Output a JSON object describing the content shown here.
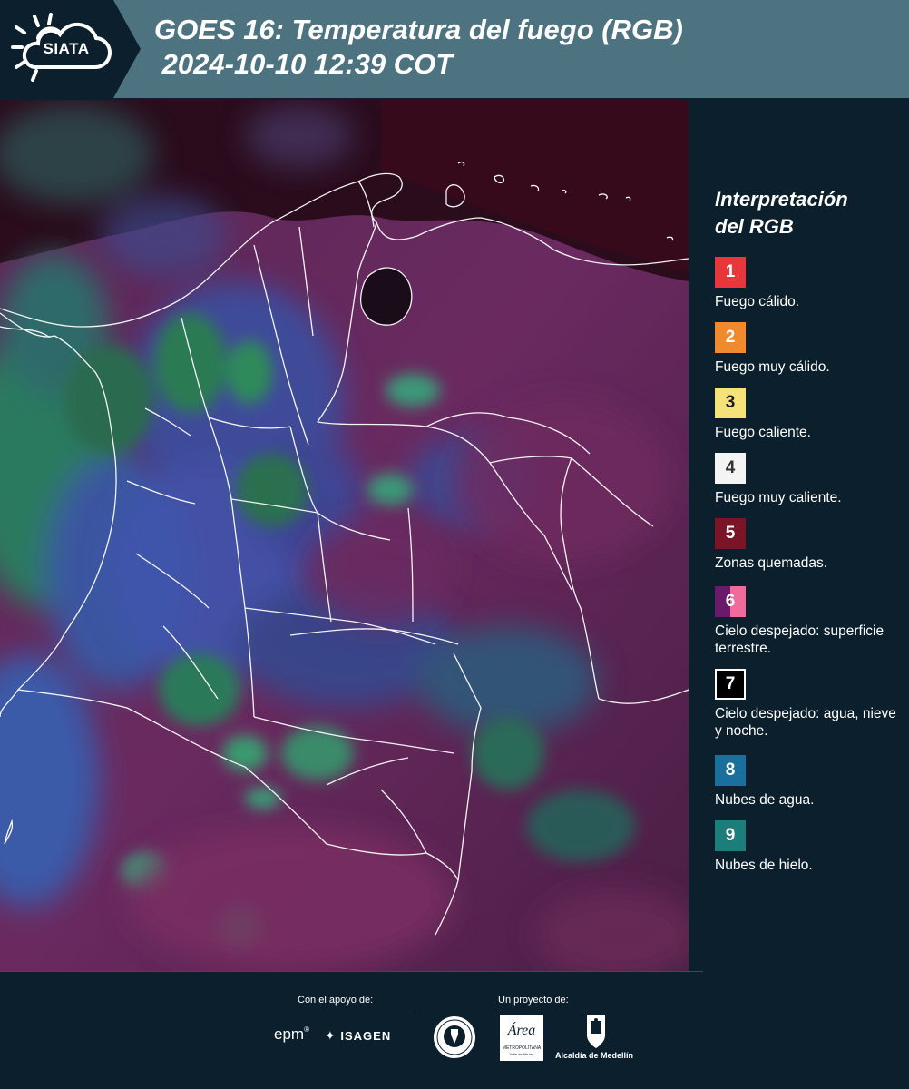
{
  "header": {
    "logo_text": "SIATA",
    "title_line1": "GOES 16: Temperatura del fuego (RGB)",
    "title_line2": " 2024-10-10 12:39 COT"
  },
  "legend": {
    "title_line1": "Interpretación",
    "title_line2": "del RGB",
    "items": [
      {
        "number": "1",
        "label": "Fuego cálido.",
        "color": "#e8363a"
      },
      {
        "number": "2",
        "label": "Fuego muy cálido.",
        "color": "#f08a2c"
      },
      {
        "number": "3",
        "label": "Fuego caliente.",
        "color": "#f7e27a",
        "text_color": "#1a1a1a"
      },
      {
        "number": "4",
        "label": "Fuego muy caliente.",
        "color": "#f4f4f4",
        "text_color": "#333333"
      },
      {
        "number": "5",
        "label": "Zonas quemadas.",
        "color": "#7a1426"
      },
      {
        "number": "6",
        "label": "Cielo despejado: superficie terrestre.",
        "color": "#6a1a6a",
        "color2": "#f06b9a"
      },
      {
        "number": "7",
        "label": "Cielo despejado: agua, nieve y noche.",
        "color": "#000000",
        "border": "#ffffff"
      },
      {
        "number": "8",
        "label": "Nubes de agua.",
        "color": "#1a6f9c"
      },
      {
        "number": "9",
        "label": "Nubes de hielo.",
        "color": "#1d7d7b"
      }
    ]
  },
  "footer": {
    "support_label": "Con el apoyo de:",
    "project_label": "Un proyecto de:",
    "sponsors": {
      "epm": "epm",
      "isagen": "ISAGEN",
      "area": "Área",
      "area_sub": "METROPOLITANA",
      "area_sub2": "Valle de Aburrá",
      "alcaldia": "Alcaldía de Medellín"
    }
  },
  "colors": {
    "background": "#0c1f2c",
    "header": "#4d7381",
    "map_land": "#5a2a55",
    "map_sea_north": "#2a0a18",
    "cloud_water": "#3a52a8",
    "cloud_ice": "#2a8a6a"
  }
}
